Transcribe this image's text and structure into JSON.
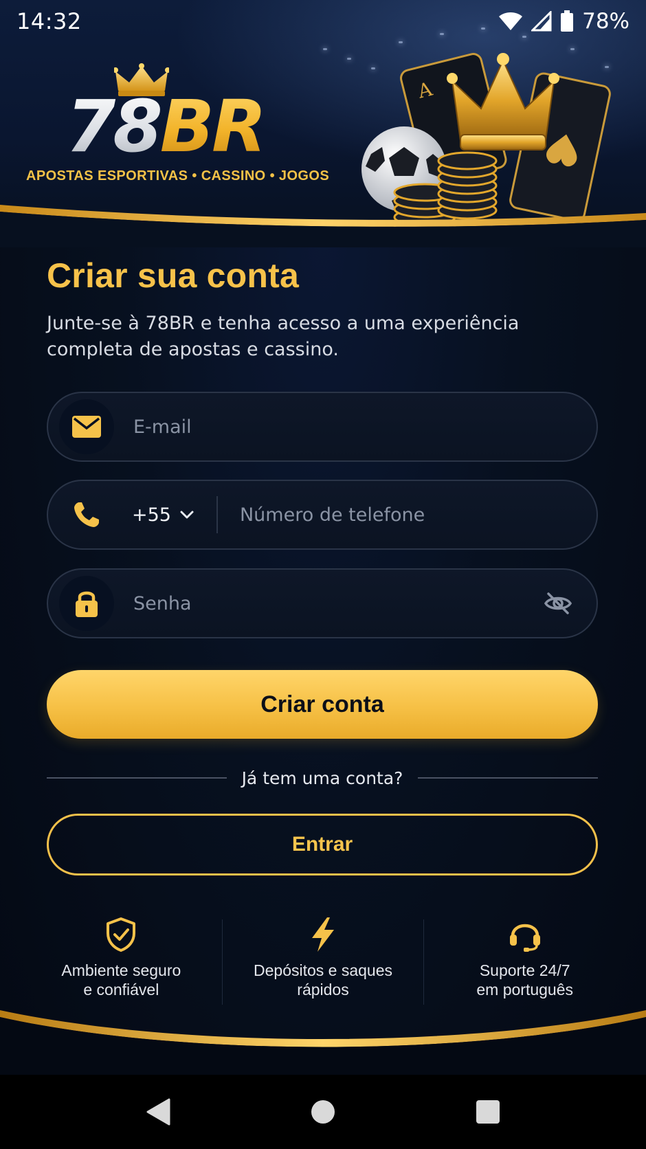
{
  "status_bar": {
    "time": "14:32",
    "battery": "78%",
    "icons": [
      "wifi-icon",
      "signal-icon",
      "battery-icon"
    ]
  },
  "brand": {
    "logo_part1": "78",
    "logo_part2": "BR",
    "tagline": "APOSTAS ESPORTIVAS • CASSINO • JOGOS",
    "colors": {
      "gold": "#f7c24a",
      "navy": "#07101f"
    }
  },
  "form": {
    "title": "Criar sua conta",
    "subtitle": "Junte-se à 78BR e tenha acesso a uma experiência completa de apostas e cassino.",
    "email": {
      "placeholder": "E-mail",
      "value": "",
      "icon": "mail-icon"
    },
    "phone": {
      "country_code": "+55",
      "placeholder": "Número de telefone",
      "value": "",
      "icon": "phone-icon"
    },
    "password": {
      "placeholder": "Senha",
      "value": "",
      "icon": "lock-icon",
      "toggle_icon": "eye-off-icon"
    },
    "submit_label": "Criar conta",
    "divider_text": "Já tem uma conta?",
    "login_label": "Entrar"
  },
  "features": [
    {
      "icon": "shield-check-icon",
      "text": "Ambiente seguro\ne confiável"
    },
    {
      "icon": "lightning-icon",
      "text": "Depósitos e saques\nrápidos"
    },
    {
      "icon": "headset-icon",
      "text": "Suporte 24/7\nem português"
    }
  ],
  "nav": [
    "back-icon",
    "home-icon",
    "recents-icon"
  ]
}
